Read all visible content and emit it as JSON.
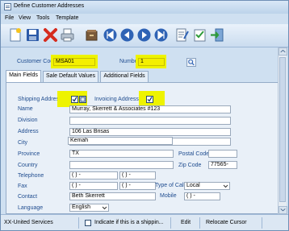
{
  "window": {
    "title": "Define Customer Addresses"
  },
  "menu": [
    "File",
    "View",
    "Tools",
    "Template"
  ],
  "toolbar": {
    "icons": [
      "new-icon",
      "save-icon",
      "delete-icon",
      "print-icon",
      "archive-icon",
      "first-record-icon",
      "previous-record-icon",
      "next-record-icon",
      "last-record-icon",
      "notes-icon",
      "checklist-icon",
      "exit-icon"
    ]
  },
  "header": {
    "customer_code_label": "Customer Code",
    "customer_code_value": "MSA01",
    "number_label": "Number",
    "number_value": "1"
  },
  "tabs": [
    "Main Fields",
    "Sale Default Values",
    "Additional Fields"
  ],
  "form": {
    "shipping_label": "Shipping Address",
    "invoicing_label": "Invoicing Address",
    "name_label": "Name",
    "name_value": "Murray, Skerrett & Associates #123",
    "division_label": "Division",
    "division_value": "",
    "address_label": "Address",
    "address_value": "106 Las Brisas",
    "address2_value": "",
    "city_label": "City",
    "city_value": "Kemah",
    "province_label": "Province",
    "province_value": "TX",
    "postal_label": "Postal Code",
    "postal_value": "",
    "country_label": "Country",
    "country_value": "",
    "zip_label": "Zip Code",
    "zip_value": "77565-",
    "telephone_label": "Telephone",
    "telephone_value": "(   )   -",
    "telephone2_value": "(   )   -",
    "fax_label": "Fax",
    "fax_value": "(   )   -",
    "fax2_value": "(   )   -",
    "type_of_call_label": "Type of Call",
    "type_of_call_value": "Local",
    "contact_label": "Contact",
    "contact_value": "Beth Skerrett",
    "mobile_label": "Mobile",
    "mobile_value": "(   )   -",
    "language_label": "Language",
    "language_value": "English"
  },
  "status": {
    "company": "XX-United Services",
    "hint": "Indicate if this is a shippin...",
    "mode": "Edit",
    "action": "Relocate Cursor"
  },
  "colors": {
    "highlight": "#eef300",
    "label_blue": "#1f4c8f"
  }
}
